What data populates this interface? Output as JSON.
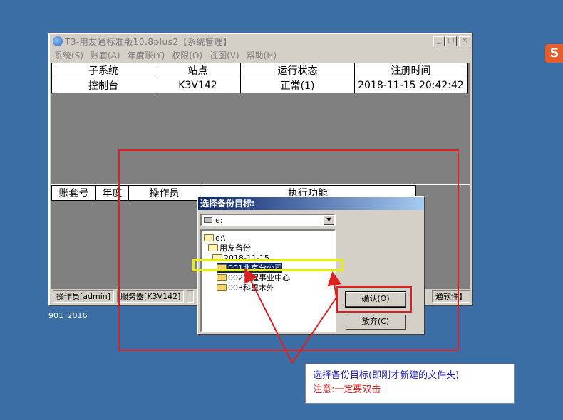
{
  "window": {
    "title": "T3-用友通标准版10.8plus2【系统管理】",
    "menus": [
      "系统(S)",
      "账套(A)",
      "年度账(Y)",
      "权限(O)",
      "视图(V)",
      "帮助(H)"
    ],
    "minimize": "_",
    "maximize": "□",
    "close": "✕"
  },
  "top_table": {
    "headers": [
      "子系统",
      "站点",
      "运行状态",
      "注册时间"
    ],
    "row": [
      "控制台",
      "K3V142",
      "正常(1)",
      "2018-11-15 20:42:42"
    ]
  },
  "bottom_table": {
    "headers": [
      "账套号",
      "年度",
      "操作员",
      "执行功能"
    ]
  },
  "statusbar": {
    "operator": "操作员[admin]",
    "server": "服务器[K3V142]",
    "s3": "",
    "right": "通软件】"
  },
  "footer_note": "901_2016",
  "dialog": {
    "title": "选择备份目标:",
    "drive": "e:",
    "tree": [
      {
        "label": "e:\\",
        "level": 0,
        "open": true
      },
      {
        "label": "用友备份",
        "level": 1,
        "open": true
      },
      {
        "label": "2018-11-15",
        "level": 2,
        "open": true
      },
      {
        "label": "001北京分公司",
        "level": 3,
        "open": false,
        "selected": true
      },
      {
        "label": "002工程事业中心",
        "level": 3,
        "open": false
      },
      {
        "label": "003科里木外",
        "level": 3,
        "open": false
      }
    ],
    "ok_label": "确认(O)",
    "cancel_label": "放弃(C)"
  },
  "callout": {
    "line1": "选择备份目标(即刚才新建的文件夹)",
    "line2": "注意:一定要双击"
  },
  "sogou_icon": "S"
}
